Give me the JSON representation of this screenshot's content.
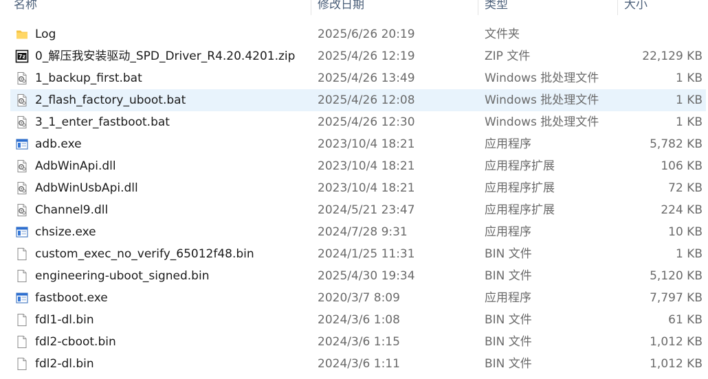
{
  "header": {
    "name": "名称",
    "date": "修改日期",
    "type": "类型",
    "size": "大小"
  },
  "files": [
    {
      "icon": "folder-icon",
      "name": "Log",
      "date": "2025/6/26 20:19",
      "type": "文件夹",
      "size": ""
    },
    {
      "icon": "7zip-archive-icon",
      "name": "0_解压我安装驱动_SPD_Driver_R4.20.4201.zip",
      "date": "2025/4/26 12:19",
      "type": "ZIP 文件",
      "size": "22,129 KB"
    },
    {
      "icon": "batch-file-icon",
      "name": "1_backup_first.bat",
      "date": "2025/4/26 13:49",
      "type": "Windows 批处理文件",
      "size": "1 KB"
    },
    {
      "icon": "batch-file-icon",
      "name": "2_flash_factory_uboot.bat",
      "date": "2025/4/26 12:08",
      "type": "Windows 批处理文件",
      "size": "1 KB",
      "selected": true
    },
    {
      "icon": "batch-file-icon",
      "name": "3_1_enter_fastboot.bat",
      "date": "2025/4/26 12:30",
      "type": "Windows 批处理文件",
      "size": "1 KB"
    },
    {
      "icon": "exe-icon",
      "name": "adb.exe",
      "date": "2023/10/4 18:21",
      "type": "应用程序",
      "size": "5,782 KB"
    },
    {
      "icon": "dll-icon",
      "name": "AdbWinApi.dll",
      "date": "2023/10/4 18:21",
      "type": "应用程序扩展",
      "size": "106 KB"
    },
    {
      "icon": "dll-icon",
      "name": "AdbWinUsbApi.dll",
      "date": "2023/10/4 18:21",
      "type": "应用程序扩展",
      "size": "72 KB"
    },
    {
      "icon": "dll-icon",
      "name": "Channel9.dll",
      "date": "2024/5/21 23:47",
      "type": "应用程序扩展",
      "size": "224 KB"
    },
    {
      "icon": "exe-icon",
      "name": "chsize.exe",
      "date": "2024/7/28 9:31",
      "type": "应用程序",
      "size": "10 KB"
    },
    {
      "icon": "file-icon",
      "name": "custom_exec_no_verify_65012f48.bin",
      "date": "2024/1/25 11:31",
      "type": "BIN 文件",
      "size": "1 KB"
    },
    {
      "icon": "file-icon",
      "name": "engineering-uboot_signed.bin",
      "date": "2025/4/30 19:34",
      "type": "BIN 文件",
      "size": "5,120 KB"
    },
    {
      "icon": "exe-icon",
      "name": "fastboot.exe",
      "date": "2020/3/7 8:09",
      "type": "应用程序",
      "size": "7,797 KB"
    },
    {
      "icon": "file-icon",
      "name": "fdl1-dl.bin",
      "date": "2024/3/6 1:08",
      "type": "BIN 文件",
      "size": "61 KB"
    },
    {
      "icon": "file-icon",
      "name": "fdl2-cboot.bin",
      "date": "2024/3/6 1:15",
      "type": "BIN 文件",
      "size": "1,012 KB"
    },
    {
      "icon": "file-icon",
      "name": "fdl2-dl.bin",
      "date": "2024/3/6 1:11",
      "type": "BIN 文件",
      "size": "1,012 KB"
    }
  ]
}
